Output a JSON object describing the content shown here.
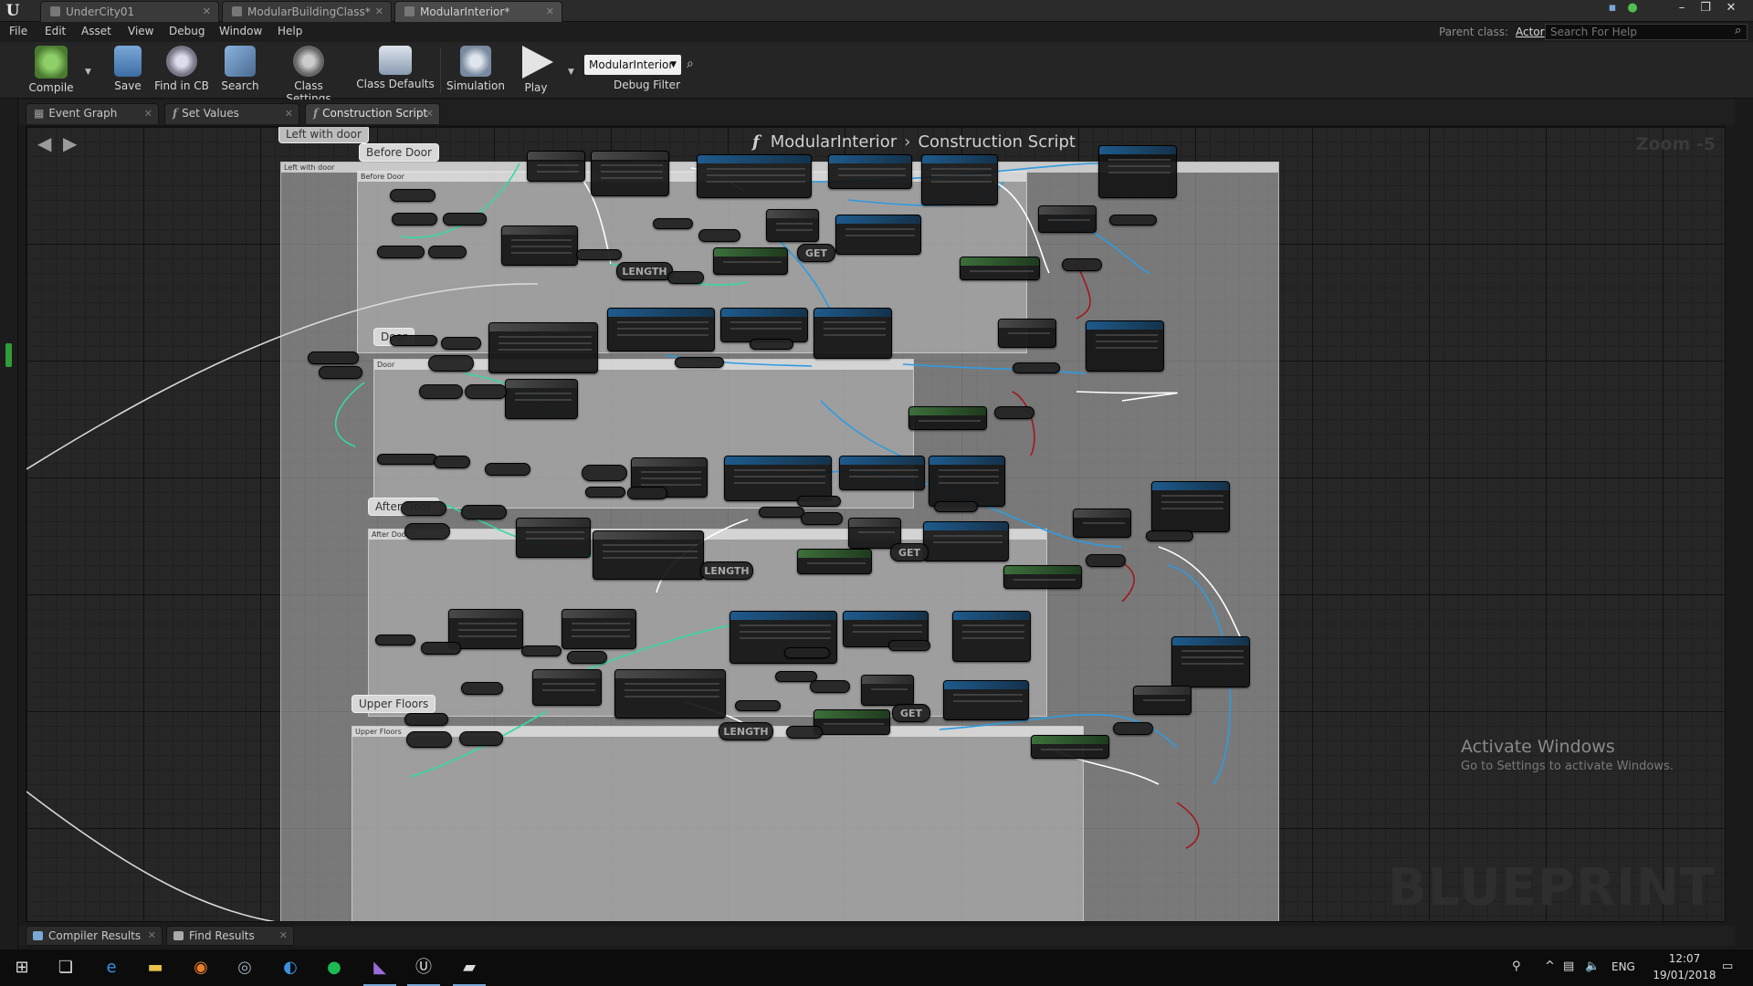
{
  "title_tabs": [
    {
      "label": "UnderCity01",
      "active": false
    },
    {
      "label": "ModularBuildingClass*",
      "active": false
    },
    {
      "label": "ModularInterior*",
      "active": true
    }
  ],
  "menu": [
    "File",
    "Edit",
    "Asset",
    "View",
    "Debug",
    "Window",
    "Help"
  ],
  "parent_class": {
    "label": "Parent class:",
    "value": "Actor"
  },
  "help_search": {
    "placeholder": "Search For Help"
  },
  "toolbar": {
    "compile": "Compile",
    "save": "Save",
    "find_in_cb": "Find in CB",
    "search": "Search",
    "class_settings": "Class Settings",
    "class_defaults": "Class Defaults",
    "simulation": "Simulation",
    "play": "Play",
    "debug_object": "ModularInterior",
    "debug_filter": "Debug Filter"
  },
  "graph_tabs": [
    {
      "label": "Event Graph",
      "active": false
    },
    {
      "label": "Set Values",
      "active": false
    },
    {
      "label": "Construction Script",
      "active": true
    }
  ],
  "graph": {
    "blueprint": "ModularInterior",
    "graph_name": "Construction Script",
    "zoom": "Zoom -5",
    "watermark": "BLUEPRINT"
  },
  "comments": [
    {
      "id": "left-with-door",
      "label": "Left with door"
    },
    {
      "id": "before-door",
      "label": "Before Door"
    },
    {
      "id": "door",
      "label": "Door"
    },
    {
      "id": "after-door",
      "label": "After Door"
    },
    {
      "id": "upper-floors",
      "label": "Upper Floors"
    }
  ],
  "node_labels": {
    "get": "GET",
    "length": "LENGTH"
  },
  "activation": {
    "title": "Activate Windows",
    "subtitle": "Go to Settings to activate Windows."
  },
  "bottom_tabs": [
    "Compiler Results",
    "Find Results"
  ],
  "taskbar": {
    "language": "ENG",
    "time": "12:07",
    "date": "19/01/2018"
  },
  "colors": {
    "exec_wire": "#ffffff",
    "object_wire": "#2f9be0",
    "int_wire": "#36d9a4",
    "bool_wire": "#a1171d",
    "float_wire": "#a6d64a"
  }
}
